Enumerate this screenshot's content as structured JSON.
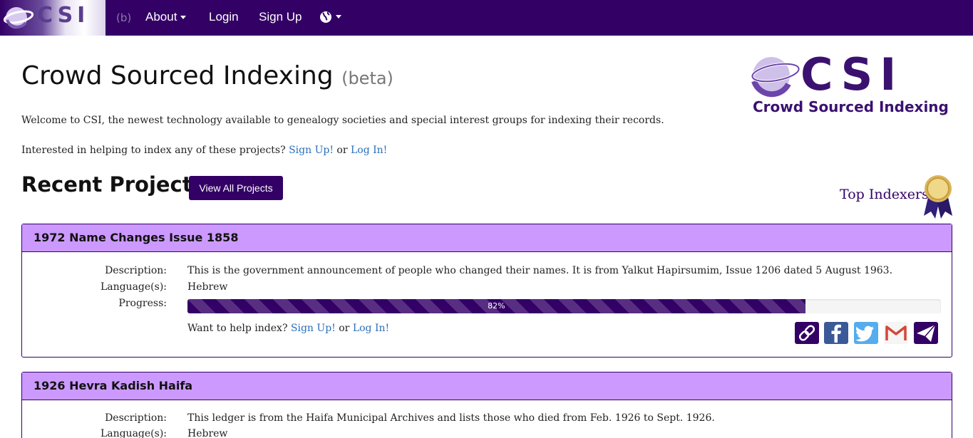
{
  "nav": {
    "brand": "CSI",
    "beta": "(b)",
    "about": "About",
    "login": "Login",
    "signup": "Sign Up"
  },
  "header": {
    "title": "Crowd Sourced Indexing",
    "title_beta": "(beta)",
    "welcome": "Welcome to CSI, the newest technology available to genealogy societies and special interest groups for indexing their records.",
    "interested": "Interested in helping to index any of these projects?",
    "signup_link": "Sign Up!",
    "or": "or",
    "login_link": "Log In!",
    "logo_csi": "CSI",
    "logo_sub": "Crowd Sourced Indexing"
  },
  "recent": {
    "title": "Recent Projects",
    "view_all": "View All Projects",
    "top_indexers": "Top Indexers"
  },
  "labels": {
    "description": "Description:",
    "languages": "Language(s):",
    "progress": "Progress:",
    "want_help": "Want to help index?"
  },
  "projects": [
    {
      "name": "1972 Name Changes Issue 1858",
      "description": "This is the government announcement of people who changed their names. It is from Yalkut Hapirsumim, Issue 1206 dated 5 August 1963.",
      "language": "Hebrew",
      "progress": 82,
      "progress_label": "82%"
    },
    {
      "name": "1926 Hevra Kadish Haifa",
      "description": "This ledger is from the Haifa Municipal Archives and lists those who died from Feb. 1926 to Sept. 1926.",
      "language": "Hebrew"
    }
  ],
  "share_icons": [
    "link-icon",
    "facebook-icon",
    "twitter-icon",
    "gmail-icon",
    "send-icon"
  ],
  "colors": {
    "navbar": "#330066",
    "panel_heading": "#cc99ff",
    "link": "#2a6ebb"
  }
}
